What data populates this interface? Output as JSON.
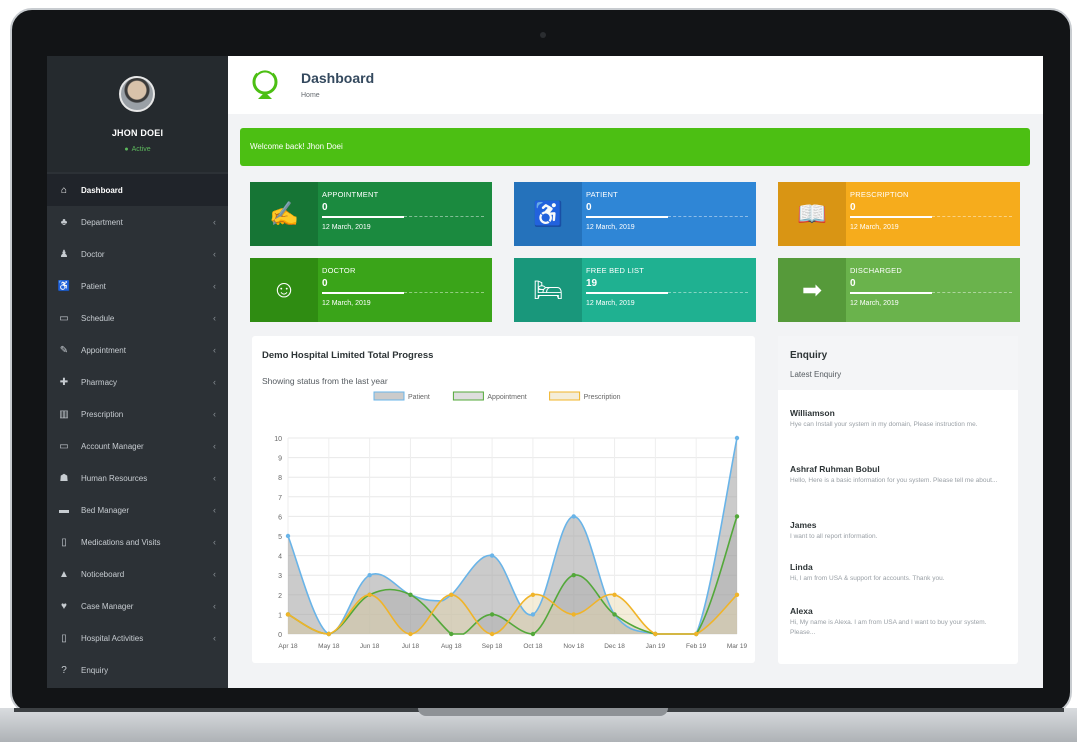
{
  "user": {
    "name": "JHON DOEI",
    "status": "Active"
  },
  "sidebar": {
    "items": [
      {
        "label": "Dashboard",
        "icon": "home-icon",
        "glyph": "⌂",
        "active": true
      },
      {
        "label": "Department",
        "icon": "sitemap-icon",
        "glyph": "♣"
      },
      {
        "label": "Doctor",
        "icon": "user-md-icon",
        "glyph": "♟"
      },
      {
        "label": "Patient",
        "icon": "wheelchair-icon",
        "glyph": "♿"
      },
      {
        "label": "Schedule",
        "icon": "calendar-icon",
        "glyph": "▭"
      },
      {
        "label": "Appointment",
        "icon": "edit-icon",
        "glyph": "✎"
      },
      {
        "label": "Pharmacy",
        "icon": "medkit-icon",
        "glyph": "✚"
      },
      {
        "label": "Prescription",
        "icon": "book-icon",
        "glyph": "▥"
      },
      {
        "label": "Account Manager",
        "icon": "credit-card-icon",
        "glyph": "▭"
      },
      {
        "label": "Human Resources",
        "icon": "users-icon",
        "glyph": "☗"
      },
      {
        "label": "Bed Manager",
        "icon": "bed-icon",
        "glyph": "▬"
      },
      {
        "label": "Medications and Visits",
        "icon": "clipboard-icon",
        "glyph": "▯"
      },
      {
        "label": "Noticeboard",
        "icon": "bell-icon",
        "glyph": "▲"
      },
      {
        "label": "Case Manager",
        "icon": "heartbeat-icon",
        "glyph": "♥"
      },
      {
        "label": "Hospital Activities",
        "icon": "hospital-icon",
        "glyph": "▯"
      },
      {
        "label": "Enquiry",
        "icon": "question-icon",
        "glyph": "?"
      }
    ]
  },
  "header": {
    "title": "Dashboard",
    "breadcrumb": "Home"
  },
  "welcome": "Welcome back! Jhon Doei",
  "cards": [
    {
      "label": "APPOINTMENT",
      "value": "0",
      "date": "12 March, 2019",
      "icon": "edit-icon",
      "glyph": "✍",
      "color": "#1b8a3f",
      "icon_bg": "#167535"
    },
    {
      "label": "PATIENT",
      "value": "0",
      "date": "12 March, 2019",
      "icon": "wheelchair-icon",
      "glyph": "♿",
      "color": "#2f86d6",
      "icon_bg": "#2572bb"
    },
    {
      "label": "PRESCRIPTION",
      "value": "0",
      "date": "12 March, 2019",
      "icon": "book-icon",
      "glyph": "📖",
      "color": "#f6ac1c",
      "icon_bg": "#d99514"
    },
    {
      "label": "DOCTOR",
      "value": "0",
      "date": "12 March, 2019",
      "icon": "user-md-icon",
      "glyph": "☺",
      "color": "#3aa419",
      "icon_bg": "#2f8c12"
    },
    {
      "label": "FREE BED LIST",
      "value": "19",
      "date": "12 March, 2019",
      "icon": "bed-icon",
      "glyph": "🛏",
      "color": "#1fb191",
      "icon_bg": "#19977b"
    },
    {
      "label": "DISCHARGED",
      "value": "0",
      "date": "12 March, 2019",
      "icon": "sign-out-icon",
      "glyph": "➡",
      "color": "#6ab34c",
      "icon_bg": "#569a3a"
    }
  ],
  "chart_panel": {
    "title": "Demo Hospital Limited Total Progress",
    "subtitle": "Showing status from the last year"
  },
  "chart_data": {
    "type": "area",
    "categories": [
      "Apr 18",
      "May 18",
      "Jun 18",
      "Jul 18",
      "Aug 18",
      "Sep 18",
      "Oct 18",
      "Nov 18",
      "Dec 18",
      "Jan 19",
      "Feb 19",
      "Mar 19"
    ],
    "x_positions": [
      0,
      1,
      2,
      3,
      4,
      5,
      6,
      7,
      8,
      9,
      10,
      11
    ],
    "ylim": [
      0,
      10
    ],
    "yticks": [
      0,
      1,
      2,
      3,
      4,
      5,
      6,
      7,
      8,
      9,
      10
    ],
    "grid": true,
    "legend": "top",
    "series": [
      {
        "name": "Patient",
        "color": "#69b4e8",
        "fill": "rgba(160,160,160,0.55)",
        "points": [
          [
            0,
            5
          ],
          [
            1,
            0
          ],
          [
            2,
            3
          ],
          [
            3,
            2
          ],
          [
            3.6,
            1.7
          ],
          [
            4,
            2
          ],
          [
            5,
            4
          ],
          [
            6,
            1
          ],
          [
            7,
            6
          ],
          [
            8,
            1
          ],
          [
            9,
            0
          ],
          [
            10,
            0
          ],
          [
            11,
            10
          ]
        ]
      },
      {
        "name": "Appointment",
        "color": "#53a83a",
        "fill": "rgba(160,160,160,0.35)",
        "points": [
          [
            0,
            1
          ],
          [
            1,
            0
          ],
          [
            2,
            2
          ],
          [
            3,
            2
          ],
          [
            4,
            0
          ],
          [
            4.3,
            0
          ],
          [
            5,
            1
          ],
          [
            6,
            0
          ],
          [
            7,
            3
          ],
          [
            8,
            1
          ],
          [
            9,
            0
          ],
          [
            10,
            0
          ],
          [
            11,
            6
          ]
        ]
      },
      {
        "name": "Prescription",
        "color": "#f0b429",
        "fill": "rgba(230,215,170,0.45)",
        "points": [
          [
            0,
            1
          ],
          [
            1,
            0
          ],
          [
            2,
            2
          ],
          [
            3,
            0
          ],
          [
            4,
            2
          ],
          [
            5,
            0
          ],
          [
            6,
            2
          ],
          [
            7,
            1
          ],
          [
            8,
            2
          ],
          [
            9,
            0
          ],
          [
            10,
            0
          ],
          [
            11,
            2
          ]
        ]
      }
    ]
  },
  "enquiry": {
    "title": "Enquiry",
    "subtitle": "Latest Enquiry",
    "messages": [
      {
        "name": "Williamson",
        "text": "Hye can Install your system in my domain, Please instruction me."
      },
      {
        "name": "Ashraf Ruhman Bobul",
        "text": "Hello, Here is a basic information for you system. Please tell me about..."
      },
      {
        "name": "James",
        "text": "I want to all report information."
      },
      {
        "name": "Linda",
        "text": "Hi, I am from USA & support for accounts. Thank you."
      },
      {
        "name": "Alexa",
        "text": "Hi, My name is Alexa. I am from USA and I want to buy your system. Please..."
      }
    ]
  }
}
